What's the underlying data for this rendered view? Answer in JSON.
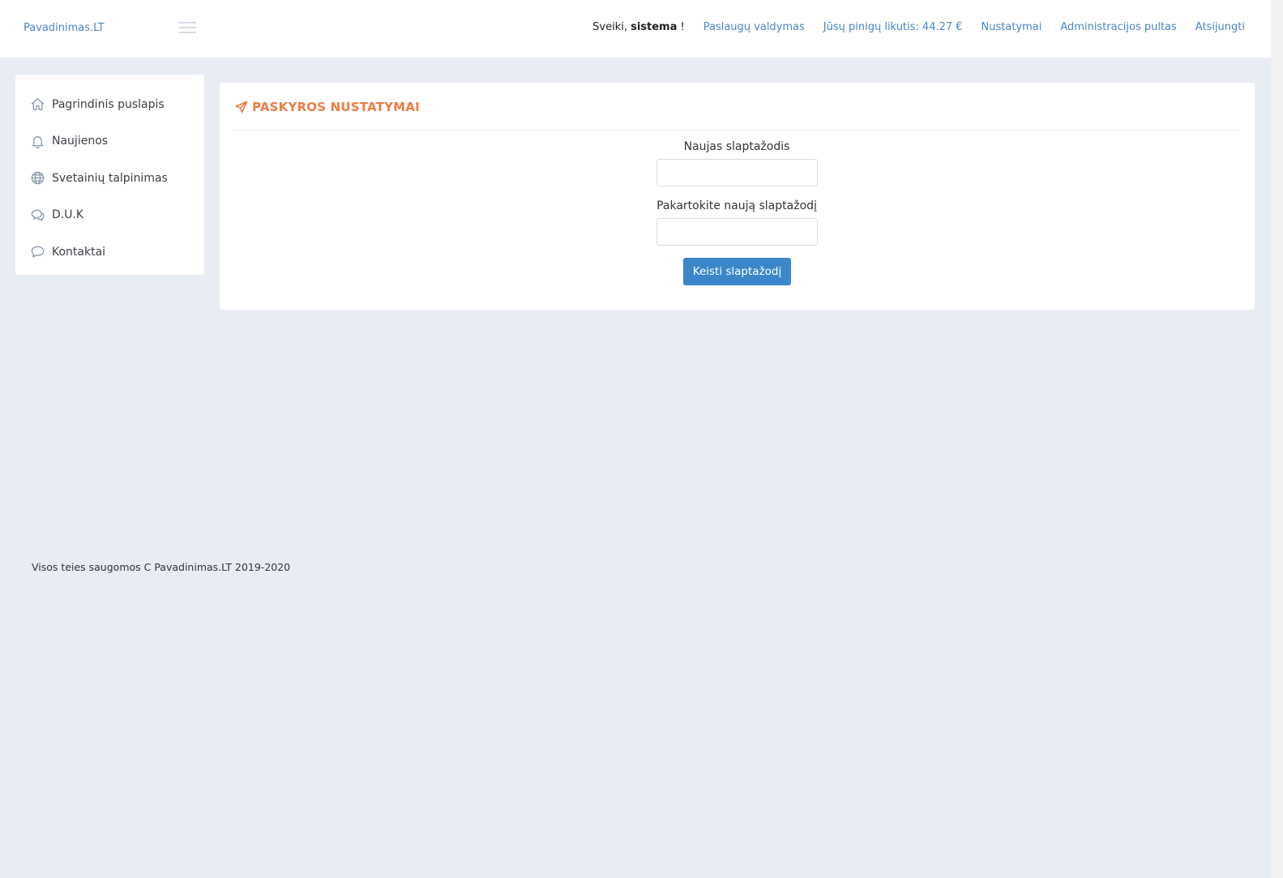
{
  "header": {
    "brand": "Pavadinimas.LT",
    "greeting_prefix": "Sveiki, ",
    "username": "sistema",
    "greeting_suffix": " !",
    "nav": [
      {
        "label": "Paslaugų valdymas"
      },
      {
        "label": "Jūsų pinigų likutis: 44.27 €"
      },
      {
        "label": "Nustatymai"
      },
      {
        "label": "Administracijos pultas"
      },
      {
        "label": "Atsijungti"
      }
    ]
  },
  "sidebar": {
    "items": [
      {
        "label": "Pagrindinis puslapis",
        "icon": "home-icon"
      },
      {
        "label": "Naujienos",
        "icon": "bell-icon"
      },
      {
        "label": "Svetainių talpinimas",
        "icon": "globe-icon"
      },
      {
        "label": "D.U.K",
        "icon": "chat-bubbles-icon"
      },
      {
        "label": "Kontaktai",
        "icon": "speech-bubble-icon"
      }
    ]
  },
  "main": {
    "title": "PASKYROS NUSTATYMAI",
    "title_icon": "paper-plane-icon",
    "form": {
      "new_password_label": "Naujas slaptažodis",
      "new_password_value": "",
      "repeat_password_label": "Pakartokite naują slaptažodį",
      "repeat_password_value": "",
      "submit_label": "Keisti slaptažodį"
    }
  },
  "footer": {
    "text": "Visos teies saugomos C Pavadinimas.LT 2019-2020"
  },
  "colors": {
    "accent": "#ee7c45",
    "link": "#4a86c5",
    "button": "#3b86c9",
    "background": "#e8ecf3"
  }
}
